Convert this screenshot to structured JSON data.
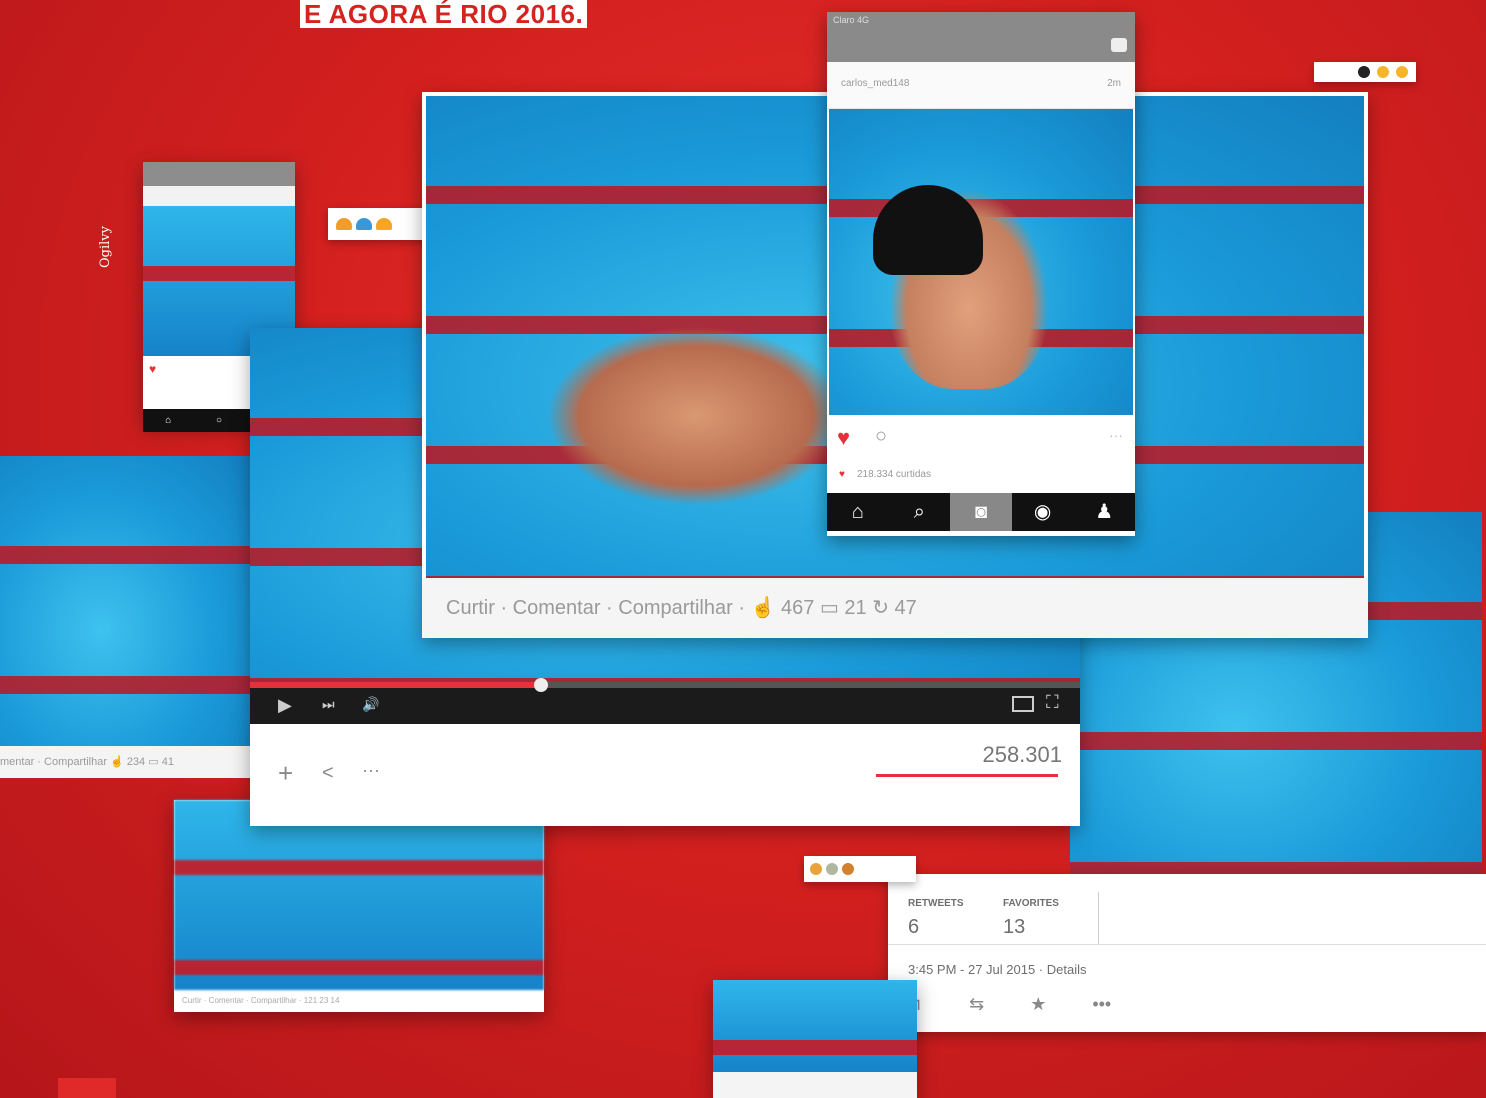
{
  "headline": "E AGORA É RIO 2016.",
  "brand": "Ogilvy",
  "fb_post": {
    "actions": [
      "Curtir",
      "Comentar",
      "Compartilhar"
    ],
    "likes": "467",
    "comments": "21",
    "shares": "47"
  },
  "fb_left": {
    "actions_text": "mentar · Compartilhar",
    "likes": "234",
    "comments": "41"
  },
  "fb_bottom": {
    "text": "Curtir · Comentar · Compartilhar · 121 23 14"
  },
  "video": {
    "views": "258.301",
    "progress": 0.35
  },
  "instagram": {
    "status": "Claro 4G",
    "username": "carlos_med148",
    "time": "2m",
    "likes": "218.334 curtidas"
  },
  "twitter": {
    "retweets_label": "RETWEETS",
    "retweets": "6",
    "favorites_label": "FAVORITES",
    "favorites": "13",
    "timestamp": "3:45 PM - 27 Jul 2015 · Details"
  },
  "colors": {
    "background": "#d4201f",
    "accent": "#e8303a",
    "pool": "#1a9ad8"
  }
}
